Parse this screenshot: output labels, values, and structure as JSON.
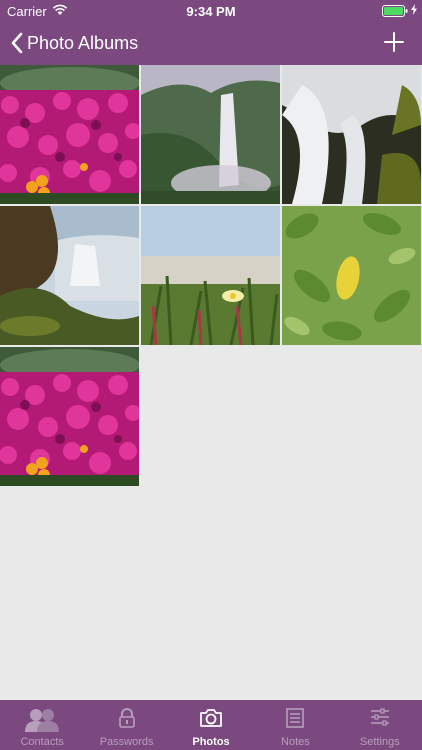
{
  "status_bar": {
    "carrier": "Carrier",
    "time": "9:34 PM"
  },
  "nav": {
    "back_label": "Photo Albums",
    "add_icon": "plus-icon",
    "back_icon": "chevron-left-icon"
  },
  "photos": [
    {
      "subject": "pink-flowers"
    },
    {
      "subject": "waterfall"
    },
    {
      "subject": "waterfall-closeup"
    },
    {
      "subject": "waterfall-coast"
    },
    {
      "subject": "dune-grass"
    },
    {
      "subject": "lemon-leaves"
    },
    {
      "subject": "pink-flowers"
    }
  ],
  "tabs": [
    {
      "label": "Contacts",
      "icon": "contacts-icon",
      "active": false
    },
    {
      "label": "Passwords",
      "icon": "lock-icon",
      "active": false
    },
    {
      "label": "Photos",
      "icon": "camera-icon",
      "active": true
    },
    {
      "label": "Notes",
      "icon": "notes-icon",
      "active": false
    },
    {
      "label": "Settings",
      "icon": "settings-icon",
      "active": false
    }
  ],
  "colors": {
    "brand": "#7b4880",
    "background": "#e9e9e9",
    "tab_inactive": "#b79fbb"
  }
}
